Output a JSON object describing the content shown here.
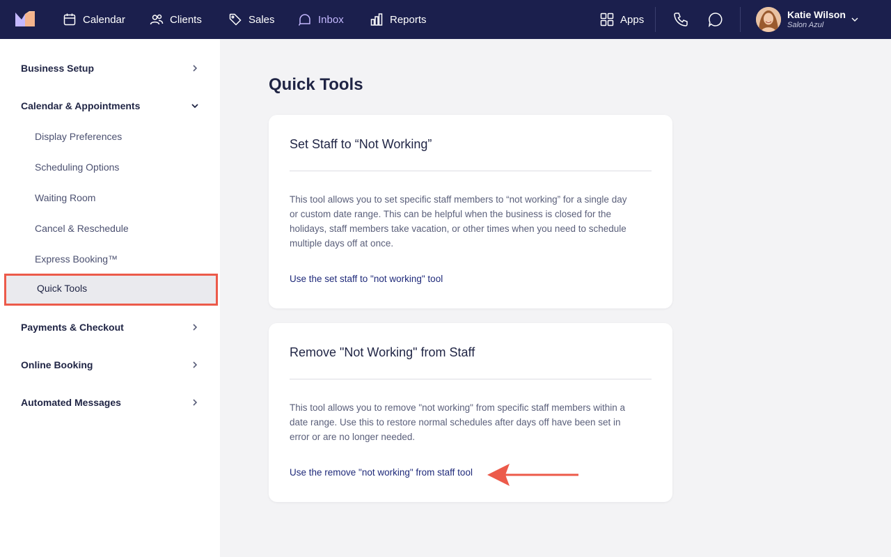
{
  "topbar": {
    "nav": [
      {
        "label": "Calendar",
        "icon": "calendar-icon"
      },
      {
        "label": "Clients",
        "icon": "users-icon"
      },
      {
        "label": "Sales",
        "icon": "tag-icon"
      },
      {
        "label": "Inbox",
        "icon": "inbox-icon"
      },
      {
        "label": "Reports",
        "icon": "bar-chart-icon"
      }
    ],
    "apps_label": "Apps",
    "user": {
      "name": "Katie Wilson",
      "business": "Salon Azul"
    },
    "colors": {
      "background": "#1b1f4d",
      "active": "#c4b8ff"
    }
  },
  "sidebar": {
    "sections": [
      {
        "label": "Business Setup"
      },
      {
        "label": "Calendar & Appointments",
        "expanded": true
      },
      {
        "label": "Payments & Checkout"
      },
      {
        "label": "Online Booking"
      },
      {
        "label": "Automated Messages"
      }
    ],
    "subitems": [
      {
        "label": "Display Preferences"
      },
      {
        "label": "Scheduling Options"
      },
      {
        "label": "Waiting Room"
      },
      {
        "label": "Cancel & Reschedule"
      },
      {
        "label": "Express Booking™"
      },
      {
        "label": "Quick Tools",
        "active": true
      }
    ],
    "highlight_color": "#ec5a4a"
  },
  "main": {
    "title": "Quick Tools",
    "cards": [
      {
        "title": "Set Staff to “Not Working”",
        "body": "This tool allows you to set specific staff members to “not working” for a single day or custom date range. This can be helpful when the business is closed for the holidays, staff members take vacation, or other times when you need to schedule multiple days off at once.",
        "link": "Use the set staff to \"not working\" tool"
      },
      {
        "title": "Remove \"Not Working\" from Staff",
        "body": "This tool allows you to remove \"not working\" from specific staff members within a date range. Use this to restore normal schedules after days off have been set in error or are no longer needed.",
        "link": "Use the remove \"not working\" from staff tool"
      }
    ]
  }
}
